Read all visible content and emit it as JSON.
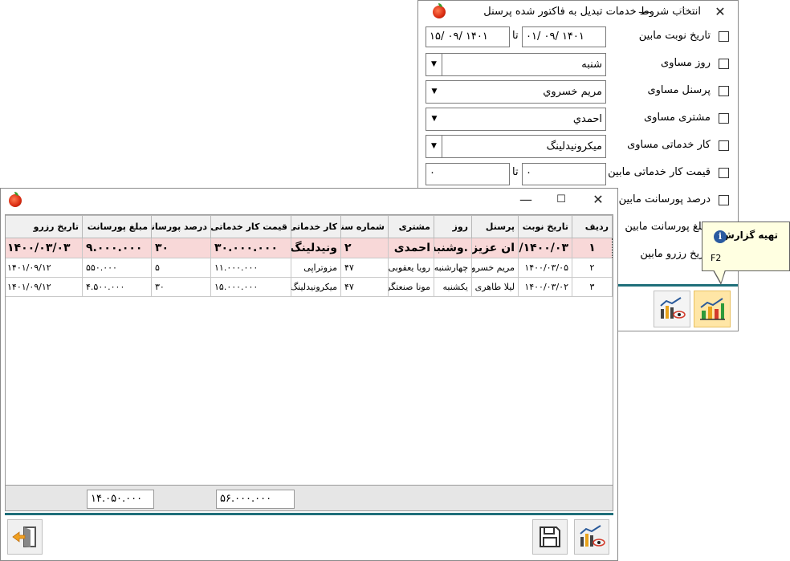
{
  "filter_window": {
    "title": "انتخاب شروط خدمات تبدیل به فاکتور شده پرسنل",
    "rows": [
      {
        "label": "تاریخ نوبت مابین",
        "from": "۰۱/ ۰۹/ ۱۴۰۱",
        "to_word": "تا",
        "to": "۱۵/ ۰۹/ ۱۴۰۱"
      },
      {
        "label": "روز مساوی",
        "value": "شنبه"
      },
      {
        "label": "پرسنل مساوی",
        "value": "مریم خسروي"
      },
      {
        "label": "مشتری مساوی",
        "value": "احمدي"
      },
      {
        "label": "کار خدماتی مساوی",
        "value": "میکرونیدلینگ"
      },
      {
        "label": "قیمت کار خدماتی مابین",
        "from": "۰",
        "to_word": "تا",
        "to": "۰"
      },
      {
        "label": "درصد پورسانت مابین"
      },
      {
        "label": "مبلغ پورسانت مابین"
      },
      {
        "label": "تاریخ رزرو مابین"
      }
    ]
  },
  "tooltip": {
    "title": "تهیه گزارش",
    "shortcut": "F2"
  },
  "report": {
    "columns": [
      "ردیف",
      "تاریخ نوبت",
      "پرسنل",
      "روز",
      "مشتری",
      "شماره سند",
      "کار خدماتی",
      "قیمت کار خدماتی",
      "درصد پورسانت",
      "مبلغ پورسانت",
      "تاریخ رزرو"
    ],
    "rows": [
      [
        "۱",
        "۱۴۰۰/۰۳/",
        "ان عزیزی",
        ".وشنبه",
        "احمدی",
        "۲",
        "ونیدلینگ",
        "۳۰.۰۰۰.۰۰۰",
        "۳۰",
        "۹.۰۰۰.۰۰۰",
        "۱۴۰۰/۰۳/۰۳"
      ],
      [
        "۲",
        "۱۴۰۰/۰۳/۰۵",
        "مریم خسروی",
        "چهارشنبه",
        "رویا یعقوبی",
        "۴۷",
        "مزوتراپی",
        "۱۱.۰۰۰.۰۰۰",
        "۵",
        "۵۵۰.۰۰۰",
        "۱۴۰۱/۰۹/۱۲"
      ],
      [
        "۳",
        "۱۴۰۰/۰۳/۰۲",
        "لیلا طاهری",
        "یکشنبه",
        "مونا صنعتگر",
        "۴۷",
        "میکرونیدلینگ",
        "۱۵.۰۰۰.۰۰۰",
        "۳۰",
        "۴.۵۰۰.۰۰۰",
        "۱۴۰۱/۰۹/۱۲"
      ]
    ],
    "totals": {
      "service_price": "۵۶.۰۰۰.۰۰۰",
      "commission_amount": "۱۴.۰۵۰.۰۰۰"
    }
  }
}
